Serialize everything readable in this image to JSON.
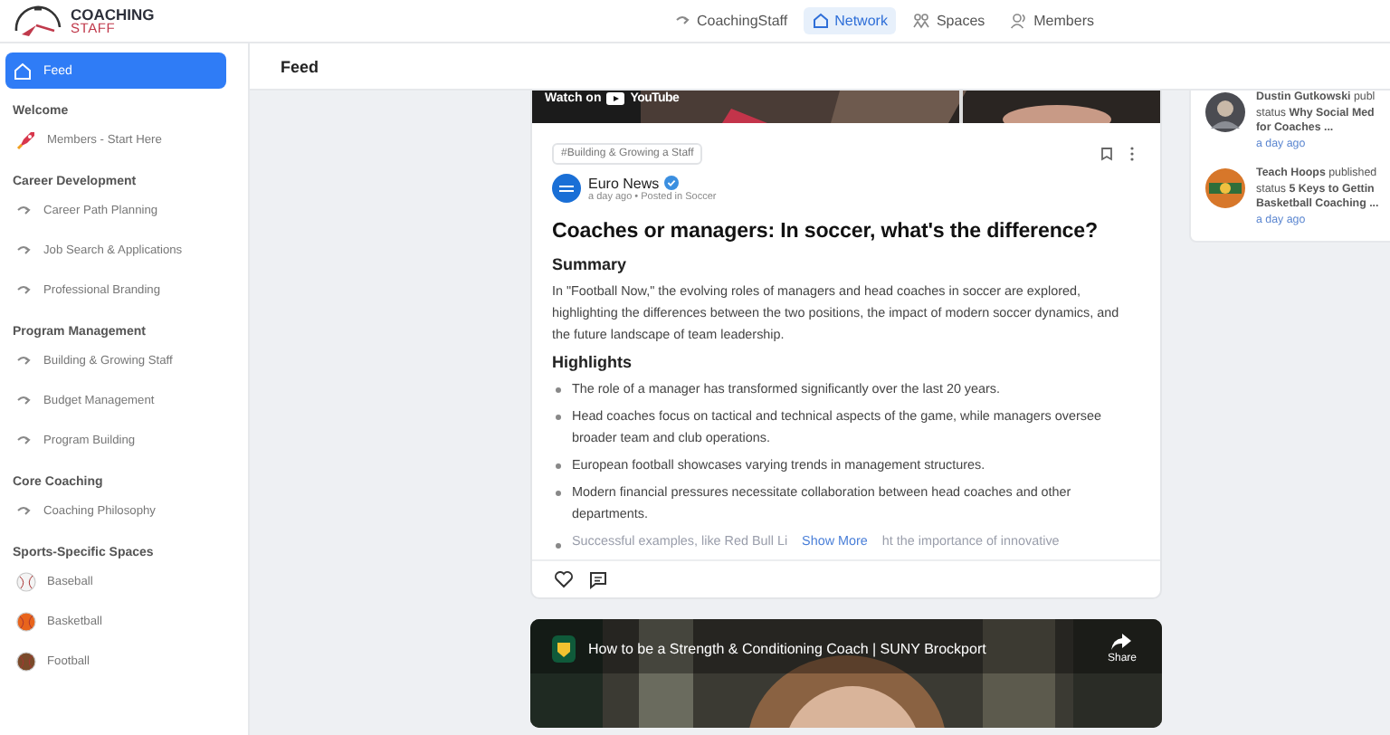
{
  "brand": {
    "line1": "COACHING",
    "line2": "STAFF"
  },
  "nav": [
    {
      "label": "CoachingStaff",
      "kind": "whistle",
      "selected": false
    },
    {
      "label": "Network",
      "kind": "home",
      "selected": true
    },
    {
      "label": "Spaces",
      "kind": "spaces",
      "selected": false
    },
    {
      "label": "Members",
      "kind": "members",
      "selected": false
    }
  ],
  "sidebar": {
    "items": [
      {
        "kind": "feed",
        "label": "Feed",
        "selected": true
      },
      {
        "kind": "heading",
        "label": "Welcome"
      },
      {
        "kind": "rocket",
        "label": "Members - Start Here",
        "selected": false
      },
      {
        "kind": "heading",
        "label": "Career Development"
      },
      {
        "kind": "link",
        "label": "Career Path Planning",
        "selected": false
      },
      {
        "kind": "link",
        "label": "Job Search & Applications",
        "selected": false
      },
      {
        "kind": "link",
        "label": "Professional Branding",
        "selected": false
      },
      {
        "kind": "heading",
        "label": "Program Management"
      },
      {
        "kind": "link",
        "label": "Building & Growing Staff",
        "selected": false
      },
      {
        "kind": "link",
        "label": "Budget Management",
        "selected": false
      },
      {
        "kind": "link",
        "label": "Program Building",
        "selected": false
      },
      {
        "kind": "heading",
        "label": "Core Coaching"
      },
      {
        "kind": "link",
        "label": "Coaching Philosophy",
        "selected": false
      },
      {
        "kind": "heading",
        "label": "Sports-Specific Spaces"
      },
      {
        "kind": "ball",
        "label": "Baseball",
        "color": "#f4f4f4",
        "selected": false
      },
      {
        "kind": "ball",
        "label": "Basketball",
        "color": "#e8641c",
        "selected": false
      },
      {
        "kind": "ball",
        "label": "Football",
        "color": "#7a4a2a",
        "selected": false
      }
    ]
  },
  "page_title": "Feed",
  "post": {
    "video": {
      "watch_on": "Watch on",
      "youtube": "YouTube"
    },
    "tag": "#Building & Growing a Staff",
    "author": {
      "name": "Euro News",
      "verified": true,
      "meta": "a day ago • Posted in Soccer"
    },
    "title": "Coaches or managers: In soccer, what's the difference?",
    "summary_heading": "Summary",
    "summary": "In \"Football Now,\" the evolving roles of managers and head coaches in soccer are explored, highlighting the differences between the two positions, the impact of modern soccer dynamics, and the future landscape of team leadership.",
    "highlights_heading": "Highlights",
    "highlights": [
      "The role of a manager has transformed significantly over the last 20 years.",
      "Head coaches focus on tactical and technical aspects of the game, while managers oversee broader team and club operations.",
      "European football showcases varying trends in management structures.",
      "Modern financial pressures necessitate collaboration between head coaches and other departments."
    ],
    "faded_highlight": {
      "before": "Successful examples, like Red Bull Li",
      "after": "ht the importance of innovative"
    },
    "show_more": "Show More"
  },
  "video_post": {
    "title": "How to be a Strength & Conditioning Coach | SUNY Brockport",
    "share": "Share"
  },
  "activity": [
    {
      "lines": [
        "**Dustin Gutkowski** publ",
        "status **Why Social Med**",
        "**for Coaches ...**"
      ],
      "time": "a day ago",
      "kind": "person"
    },
    {
      "lines": [
        "**Teach Hoops** published",
        "status **5 Keys to Gettin**",
        "**Basketball Coaching ...**"
      ],
      "time": "a day ago",
      "kind": "logo"
    }
  ]
}
